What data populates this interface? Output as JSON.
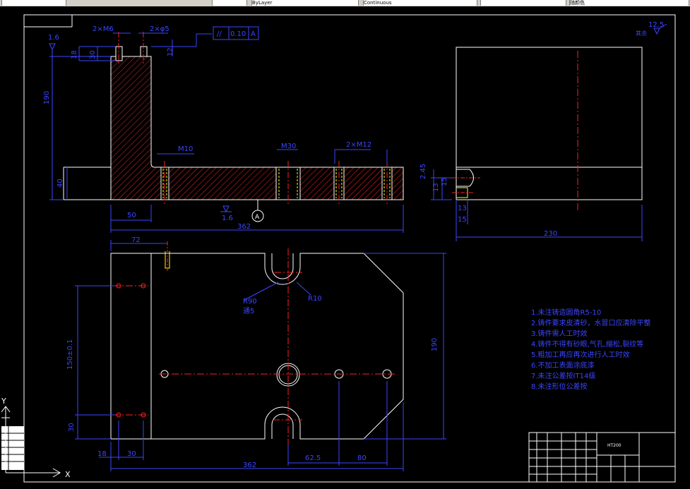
{
  "toolbar": {
    "fields": [
      {
        "label": "ByLayer"
      },
      {
        "label": "Continuous"
      },
      {
        "label": ""
      },
      {
        "label": "随颜色"
      }
    ]
  },
  "dimensions": {
    "top_view": {
      "d1": "1.6",
      "d2": "2×M6",
      "d3": "2×φ5",
      "d4": "18",
      "d5": "30",
      "d6": "190",
      "d7": "40",
      "d8": "50",
      "d9": "M10",
      "d10": "M30",
      "d11": "2×M12",
      "d12": "1.6",
      "d13": "362",
      "datum": "A",
      "d14": "12"
    },
    "tolerance_frame": {
      "symbol": "//",
      "value": "0.10",
      "datum": "A"
    },
    "side_view": {
      "roughness": "12.5",
      "roughness_note": "其余",
      "d1": "2.45",
      "d2": "13",
      "d3": "15",
      "d4": "13",
      "d5": "15",
      "d6": "230"
    },
    "plan_view": {
      "d1": "72",
      "d2": "R90",
      "d3": "通5",
      "d4": "R10",
      "d5": "150±0.1",
      "d6": "190",
      "d7": "30",
      "d8": "18",
      "d9": "30",
      "d10": "362",
      "d11": "62.5",
      "d12": "80"
    }
  },
  "notes": [
    "1.未注铸造圆角R5-10",
    "2.铸件要求皮清砂，水冒口应清除平整",
    "3.铸件需人工时效",
    "4.铸件不得有砂眼,气孔,缩松,裂纹等",
    "5.粗加工再应再次进行人工时效",
    "6.不加工表面涂底漆",
    "7.未注公差按IT14级",
    "8.未注形位公差按"
  ],
  "title_block": {
    "material": "HT200",
    "drawing_name": ""
  },
  "ucs": {
    "x": "X",
    "y": "Y"
  },
  "colors": {
    "outline": "#ffffff",
    "dimension": "#3b46ff",
    "centerline": "#ff2020",
    "hatch": "#ff2020",
    "yellow": "#ffff00",
    "background": "#000000"
  }
}
